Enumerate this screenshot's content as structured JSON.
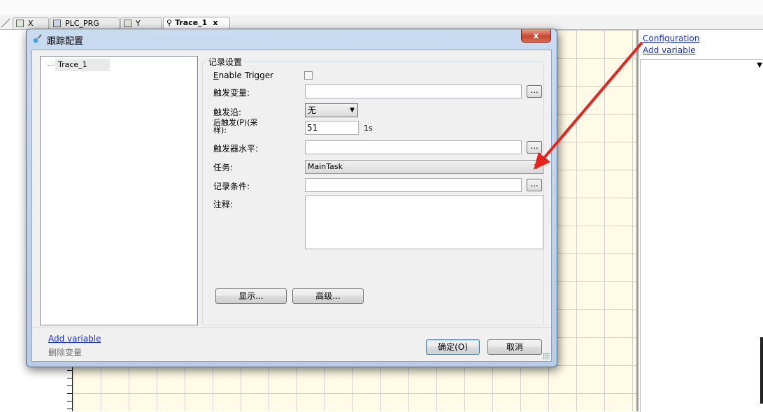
{
  "editor_tabs": [
    {
      "label": "X"
    },
    {
      "label": "PLC_PRG"
    },
    {
      "label": "Y"
    },
    {
      "label": "Trace_1",
      "close": "x"
    }
  ],
  "right_panel": {
    "configuration_link": "Configuration",
    "add_variable_link": "Add variable"
  },
  "dialog": {
    "title": "跟踪配置",
    "close_glyph": "x",
    "tree": {
      "items": [
        "Trace_1"
      ]
    },
    "group_title": "记录设置",
    "enable_trigger_label_pre": "E",
    "enable_trigger_label_post": "nable Trigger",
    "trigger_var_label": "触发变量:",
    "trigger_edge_label": "触发沿:",
    "trigger_edge_value": "无",
    "post_trigger_label_line1": "后触发(P)(采",
    "post_trigger_label_line2": "样):",
    "post_trigger_value": "51",
    "post_trigger_unit": "1s",
    "trigger_level_label": "触发器水平:",
    "task_label": "任务:",
    "task_value": "MainTask",
    "record_condition_label": "记录条件:",
    "comment_label": "注释:",
    "ellipsis": "...",
    "display_button": "显示...",
    "advanced_button": "高级...",
    "add_variable_link": "Add variable",
    "delete_variable": "删除变量",
    "ok_button": "确定(O)",
    "cancel_button": "取消"
  },
  "colors": {
    "link": "#1a33c4",
    "arrow": "#e8231d",
    "chart_background": "#fffbe6"
  }
}
